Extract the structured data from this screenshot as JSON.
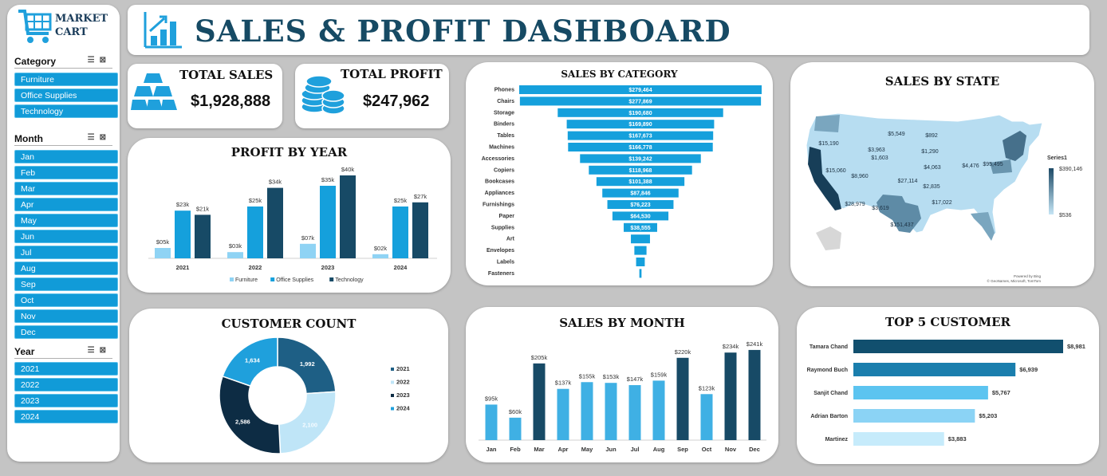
{
  "brand": {
    "line1": "MARKET",
    "line2": "CART"
  },
  "title": "SALES & PROFIT DASHBOARD",
  "slicers": {
    "category": {
      "label": "Category",
      "items": [
        "Furniture",
        "Office Supplies",
        "Technology"
      ]
    },
    "month": {
      "label": "Month",
      "items": [
        "Jan",
        "Feb",
        "Mar",
        "Apr",
        "May",
        "Jun",
        "Jul",
        "Aug",
        "Sep",
        "Oct",
        "Nov",
        "Dec"
      ]
    },
    "year": {
      "label": "Year",
      "items": [
        "2021",
        "2022",
        "2023",
        "2024"
      ]
    }
  },
  "kpis": {
    "total_sales": {
      "label": "TOTAL SALES",
      "value": "$1,928,888"
    },
    "total_profit": {
      "label": "TOTAL PROFIT",
      "value": "$247,962"
    }
  },
  "colors": {
    "furniture": "#8fd3f4",
    "office": "#15a0dc",
    "technology": "#174a66",
    "category_bar": "#15a0dc",
    "month_light": "#3fb0e4",
    "month_dark": "#174a66"
  },
  "chart_data": [
    {
      "id": "profit_by_year",
      "type": "bar",
      "title": "PROFIT BY YEAR",
      "categories": [
        "2021",
        "2022",
        "2023",
        "2024"
      ],
      "ylim": [
        0,
        45
      ],
      "series": [
        {
          "name": "Furniture",
          "values": [
            5,
            3,
            7,
            2
          ],
          "labels": [
            "$05k",
            "$03k",
            "$07k",
            "$02k"
          ]
        },
        {
          "name": "Office Supplies",
          "values": [
            23,
            25,
            35,
            25
          ],
          "labels": [
            "$23k",
            "$25k",
            "$35k",
            "$25k"
          ]
        },
        {
          "name": "Technology",
          "values": [
            21,
            34,
            40,
            27
          ],
          "labels": [
            "$21k",
            "$34k",
            "$40k",
            "$27k"
          ]
        }
      ]
    },
    {
      "id": "sales_by_category",
      "type": "bar",
      "orientation": "horizontal-centered",
      "title": "SALES BY CATEGORY",
      "categories": [
        "Phones",
        "Chairs",
        "Storage",
        "Binders",
        "Tables",
        "Machines",
        "Accessories",
        "Copiers",
        "Bookcases",
        "Appliances",
        "Furnishings",
        "Paper",
        "Supplies",
        "Art",
        "Envelopes",
        "Labels",
        "Fasteners"
      ],
      "values": [
        279464,
        277869,
        190680,
        169890,
        167673,
        166778,
        139242,
        118968,
        101388,
        87846,
        76223,
        64530,
        38555,
        22000,
        14000,
        10000,
        2500
      ],
      "labels": [
        "$279,464",
        "$277,869",
        "$190,680",
        "$169,890",
        "$167,673",
        "$166,778",
        "$139,242",
        "$118,968",
        "$101,388",
        "$87,846",
        "$76,223",
        "$64,530",
        "$38,555",
        "",
        "",
        "",
        ""
      ]
    },
    {
      "id": "sales_by_state",
      "type": "map",
      "title": "SALES BY STATE",
      "legend_title": "Series1",
      "range_labels": [
        "$390,146",
        "$536"
      ],
      "labels": [
        "$15,190",
        "$5,549",
        "$892",
        "$3,963",
        "$1,290",
        "$15,060",
        "$1,603",
        "$4,476",
        "$8,960",
        "$27,114",
        "$4,063",
        "$95,495",
        "$2,835",
        "$28,979",
        "$3,619",
        "$17,022",
        "$151,437"
      ],
      "credits": [
        "Powered by Bing",
        "© GeoNames, Microsoft, TomTom"
      ]
    },
    {
      "id": "customer_count",
      "type": "pie",
      "title": "CUSTOMER COUNT",
      "categories": [
        "2021",
        "2022",
        "2023",
        "2024"
      ],
      "values": [
        1992,
        2100,
        2586,
        1634
      ],
      "labels": [
        "1,992",
        "2,100",
        "2,586",
        "1,634"
      ],
      "colors": [
        "#1e5f85",
        "#bfe5f7",
        "#0d2c44",
        "#1fa0dc"
      ]
    },
    {
      "id": "sales_by_month",
      "type": "bar",
      "title": "SALES BY MONTH",
      "categories": [
        "Jan",
        "Feb",
        "Mar",
        "Apr",
        "May",
        "Jun",
        "Jul",
        "Aug",
        "Sep",
        "Oct",
        "Nov",
        "Dec"
      ],
      "values": [
        95,
        60,
        205,
        137,
        155,
        153,
        147,
        159,
        220,
        123,
        234,
        241
      ],
      "labels": [
        "$95k",
        "$60k",
        "$205k",
        "$137k",
        "$155k",
        "$153k",
        "$147k",
        "$159k",
        "$220k",
        "$123k",
        "$234k",
        "$241k"
      ],
      "ylim": [
        0,
        260
      ]
    },
    {
      "id": "top5_customer",
      "type": "bar",
      "orientation": "horizontal",
      "title": "TOP 5 CUSTOMER",
      "categories": [
        "Tamara Chand",
        "Raymond Buch",
        "Sanjit Chand",
        "Adrian Barton",
        "Martinez"
      ],
      "values": [
        8981,
        6939,
        5767,
        5203,
        3883
      ],
      "labels": [
        "$8,981",
        "$6,939",
        "$5,767",
        "$5,203",
        "$3,883"
      ],
      "colors": [
        "#114f6e",
        "#1a7ead",
        "#5cc4f0",
        "#8bd3f5",
        "#c6ebfb"
      ]
    }
  ]
}
